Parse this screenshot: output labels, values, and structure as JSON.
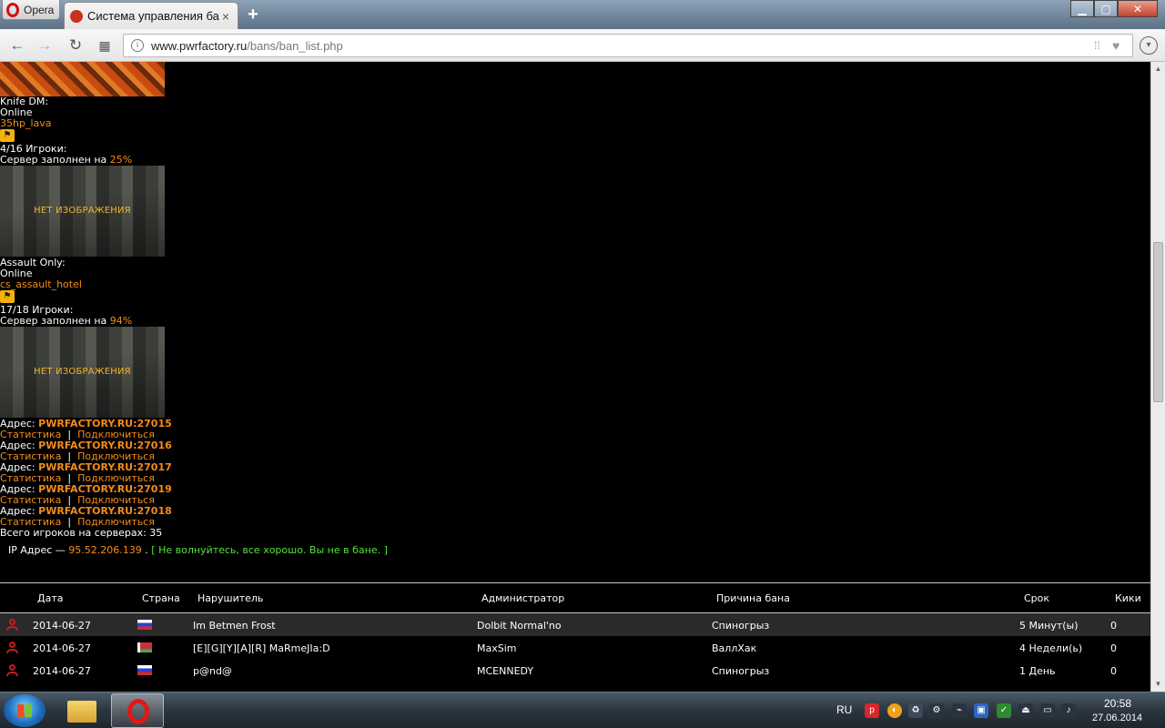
{
  "browser": {
    "menu_label": "Opera",
    "tab_title": "Система управления бан",
    "tab_close": "×",
    "new_tab": "+",
    "url_domain": "www.pwrfactory.ru",
    "url_path": "/bans/ban_list.php"
  },
  "servers": [
    {
      "name": "Knife DM:",
      "status": "Online",
      "map": "35hp_lava",
      "players": "4/16 Игроки:",
      "fill_prefix": "Сервер заполнен на ",
      "fill_percent": "25%"
    },
    {
      "name": "Assault Only:",
      "status": "Online",
      "map": "cs_assault_hotel",
      "players": "17/18 Игроки:",
      "fill_prefix": "Сервер заполнен на ",
      "fill_percent": "94%"
    }
  ],
  "no_image_text": "НЕТ ИЗОБРАЖЕНИЯ",
  "address_label": "Адрес: ",
  "addresses": [
    "PWRFACTORY.RU:27015",
    "PWRFACTORY.RU:27016",
    "PWRFACTORY.RU:27017",
    "PWRFACTORY.RU:27019",
    "PWRFACTORY.RU:27018"
  ],
  "links": {
    "stats": "Статистика",
    "sep": "|",
    "connect": "Подключиться"
  },
  "total_players": "Всего игроков на серверах: 35",
  "ip": {
    "label": "IP Адрес — ",
    "value": "95.52.206.139",
    "dot": " . ",
    "message": "[ Не волнуйтесь, все хорошо. Вы не в бане. ]"
  },
  "table": {
    "headers": {
      "date": "Дата",
      "country": "Страна",
      "offender": "Нарушитель",
      "admin": "Администратор",
      "reason": "Причина бана",
      "term": "Срок",
      "kicks": "Кики"
    },
    "rows": [
      {
        "date": "2014-06-27",
        "flag": "ru",
        "offender": "Im Betmen Frost",
        "admin": "Dolbit Normal'no",
        "reason": "Спиногрыз",
        "term": "5 Минут(ы)",
        "kicks": "0"
      },
      {
        "date": "2014-06-27",
        "flag": "by",
        "offender": "[E][G][Y][A][R] MaRmeJIa:D",
        "admin": "MaxSim",
        "reason": "ВаллХак",
        "term": "4 Недели(ь)",
        "kicks": "0"
      },
      {
        "date": "2014-06-27",
        "flag": "ru",
        "offender": "p@nd@",
        "admin": "MCENNEDY",
        "reason": "Спиногрыз",
        "term": "1 День",
        "kicks": "0"
      }
    ]
  },
  "taskbar": {
    "lang": "RU",
    "time": "20:58",
    "date": "27.06.2014"
  },
  "colors": {
    "accent_orange": "#f58b1a",
    "ok_green": "#56e03c",
    "ban_icon_red": "#c0201a"
  }
}
